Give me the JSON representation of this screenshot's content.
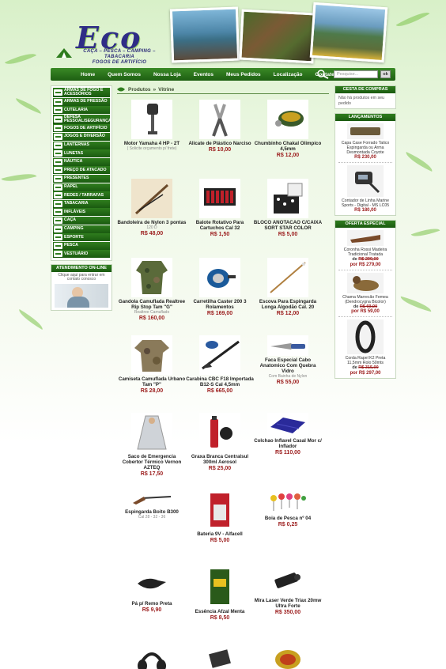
{
  "brand": {
    "logo_text": "Eco",
    "tagline_1": "CAÇA – PESCA – CAMPING – TABACARIA",
    "tagline_2": "FOGOS DE ARTIFÍCIO"
  },
  "nav": {
    "items": [
      "Home",
      "Quem Somos",
      "Nossa Loja",
      "Eventos",
      "Meus Pedidos",
      "Localização",
      "Contate-nos"
    ],
    "search_placeholder": "Pesquise...",
    "search_button": "ok"
  },
  "breadcrumb": {
    "items": [
      "Produtos",
      "Vitrine"
    ],
    "separator": "»"
  },
  "categories": [
    "ARMAS DE FOGO E ACESSÓRIOS",
    "ARMAS DE PRESSÃO",
    "CUTELARIA",
    "DEFESA PESSOAL/SEGURANÇA",
    "FOGOS DE ARTIFÍCIO",
    "JOGOS E DIVERSÃO",
    "LANTERNAS",
    "LUNETAS",
    "NÁUTICA",
    "PREÇO DE ATACADO",
    "PRESENTES",
    "RAPEL",
    "REDES / TARRAFAS",
    "TABACARIA",
    "INFLÁVEIS",
    "CAÇA",
    "CAMPING",
    "ESPORTE",
    "PESCA",
    "VESTUÁRIO"
  ],
  "attendance": {
    "title": "ATENDIMENTO ON-LINE",
    "text": "Clique aqui para entrar em contato conosco"
  },
  "products": [
    {
      "name": "Motor Yamaha 4 HP - 2T",
      "note": "( Solicite orçamento p/ frete)",
      "price": ""
    },
    {
      "name": "Alicate de Plástico Narciso",
      "note": "",
      "price": "R$ 10,00"
    },
    {
      "name": "Chumbinho Chakal Olimpico 4,5mm",
      "note": "",
      "price": "R$ 12,00"
    },
    {
      "name": "Bandoleira de Nylon 3 pontas",
      "note": "120 D",
      "price": "R$ 48,00"
    },
    {
      "name": "Balote Rotativo Para Cartuchos Cal 32",
      "note": "",
      "price": "R$ 1,50"
    },
    {
      "name": "BLOCO ANOTACAO C/CAIXA SORT STAR COLOR",
      "note": "",
      "price": "R$ 5,00"
    },
    {
      "name": "Gandola Camuflada Realtree Rip Stop Tam \"G\"",
      "note": "Realtree Camuflado",
      "price": "R$ 160,00"
    },
    {
      "name": "Carretilha Caster 200 3 Rolamentos",
      "note": "",
      "price": "R$ 169,00"
    },
    {
      "name": "Escova Para Espingarda Longa Algodão Cal. 20",
      "note": "",
      "price": "R$ 12,00"
    },
    {
      "name": "Camiseta Camuflada Urbano Tam \"P\"",
      "note": "",
      "price": "R$ 28,00"
    },
    {
      "name": "Carabina CBC F18 Importada B12-S Cal 4,5mm",
      "note": "",
      "price": "R$ 665,00"
    },
    {
      "name": "Faca Especial Cabo Anatomico Com Quebra Vidro",
      "note": "Com Bainha de Nylon",
      "price": "R$ 55,00"
    },
    {
      "name": "Saco de Emergencia Cobertor Térmico Vernon AZTEQ",
      "note": "",
      "price": "R$ 17,50"
    },
    {
      "name": "Graxa Branca Centralsul 300ml Aerosol",
      "note": "",
      "price": "R$ 25,00"
    },
    {
      "name": "Colchao Inflavel Casal Mor c/ Inflador",
      "note": "",
      "price": "R$ 110,00"
    },
    {
      "name": "Espingarda Boito B300",
      "note": "Cal 28 - 32 - 36",
      "price": ""
    },
    {
      "name": "Bateria 9V - Alfacell",
      "note": "",
      "price": "R$ 5,00"
    },
    {
      "name": "Boia de Pesca nº 04",
      "note": "",
      "price": "R$ 0,25"
    },
    {
      "name": "Pá p/ Remo Preta",
      "note": "",
      "price": "R$ 9,90"
    },
    {
      "name": "Essência Afzal Menta",
      "note": "",
      "price": "R$ 8,50"
    },
    {
      "name": "Mira Laser Verde Triax 20mw Ultra Forte",
      "note": "",
      "price": "R$ 350,00"
    }
  ],
  "cart": {
    "title": "CESTA DE COMPRAS",
    "text": "Não há produtos em seu pedido"
  },
  "launches": {
    "title": "LANÇAMENTOS",
    "items": [
      {
        "name": "Capa Case Forrado Tatico Espingarda ou Arma Desmontada Coyote",
        "price": "R$ 230,00"
      },
      {
        "name": "Contador de Linha Marine Sports - Digital - MS LC05",
        "price": "R$ 180,00"
      }
    ]
  },
  "offers": {
    "title": "OFERTA ESPECIAL",
    "de_label": "de",
    "por_label": "por",
    "items": [
      {
        "name": "Coronha Rossi Madeira Tradicional Tratada",
        "old": "R$ 299,00",
        "price": "R$ 279,00"
      },
      {
        "name": "Chama Marrecão Femea (Dendrocygna Bicolor)",
        "old": "R$ 69,00",
        "price": "R$ 59,00"
      },
      {
        "name": "Corda Rapel K2 Preta 11,5mm Rolo 50mts",
        "old": "R$ 315,00",
        "price": "R$ 297,00"
      }
    ]
  },
  "colors": {
    "nav_green": "#1d5e12",
    "price_red": "#9b1c1c",
    "brand_blue": "#2f2d86"
  }
}
